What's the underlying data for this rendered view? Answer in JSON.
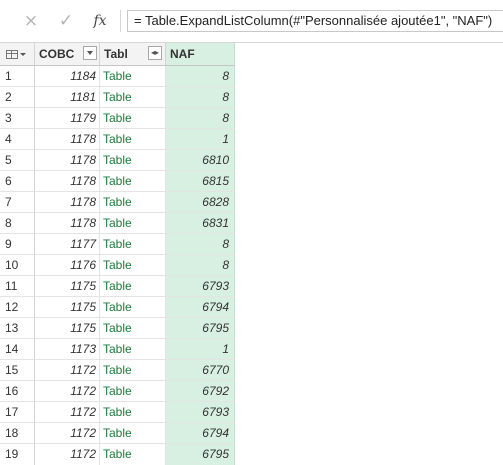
{
  "formula_bar": {
    "cancel_icon": "×",
    "commit_icon": "✓",
    "fx_label": "fx",
    "formula": "= Table.ExpandListColumn(#\"Personnalisée ajoutée1\", \"NAF\")"
  },
  "grid": {
    "columns": [
      {
        "name": "COBC",
        "control": "dropdown"
      },
      {
        "name": "Tabl",
        "control": "expand"
      },
      {
        "name": "NAF",
        "control": "none",
        "selected": true
      }
    ],
    "expand_icon": "◂▸",
    "rows": [
      {
        "idx": "1",
        "cobc": "1184",
        "tabl": "Table",
        "naf": "8"
      },
      {
        "idx": "2",
        "cobc": "1181",
        "tabl": "Table",
        "naf": "8"
      },
      {
        "idx": "3",
        "cobc": "1179",
        "tabl": "Table",
        "naf": "8"
      },
      {
        "idx": "4",
        "cobc": "1178",
        "tabl": "Table",
        "naf": "1"
      },
      {
        "idx": "5",
        "cobc": "1178",
        "tabl": "Table",
        "naf": "6810"
      },
      {
        "idx": "6",
        "cobc": "1178",
        "tabl": "Table",
        "naf": "6815"
      },
      {
        "idx": "7",
        "cobc": "1178",
        "tabl": "Table",
        "naf": "6828"
      },
      {
        "idx": "8",
        "cobc": "1178",
        "tabl": "Table",
        "naf": "6831"
      },
      {
        "idx": "9",
        "cobc": "1177",
        "tabl": "Table",
        "naf": "8"
      },
      {
        "idx": "10",
        "cobc": "1176",
        "tabl": "Table",
        "naf": "8"
      },
      {
        "idx": "11",
        "cobc": "1175",
        "tabl": "Table",
        "naf": "6793"
      },
      {
        "idx": "12",
        "cobc": "1175",
        "tabl": "Table",
        "naf": "6794"
      },
      {
        "idx": "13",
        "cobc": "1175",
        "tabl": "Table",
        "naf": "6795"
      },
      {
        "idx": "14",
        "cobc": "1173",
        "tabl": "Table",
        "naf": "1"
      },
      {
        "idx": "15",
        "cobc": "1172",
        "tabl": "Table",
        "naf": "6770"
      },
      {
        "idx": "16",
        "cobc": "1172",
        "tabl": "Table",
        "naf": "6792"
      },
      {
        "idx": "17",
        "cobc": "1172",
        "tabl": "Table",
        "naf": "6793"
      },
      {
        "idx": "18",
        "cobc": "1172",
        "tabl": "Table",
        "naf": "6794"
      },
      {
        "idx": "19",
        "cobc": "1172",
        "tabl": "Table",
        "naf": "6795"
      }
    ]
  },
  "colors": {
    "selected_column_fill": "#d7f0e1",
    "table_link": "#1f7a3d",
    "header_fill": "#f3f3f3"
  }
}
